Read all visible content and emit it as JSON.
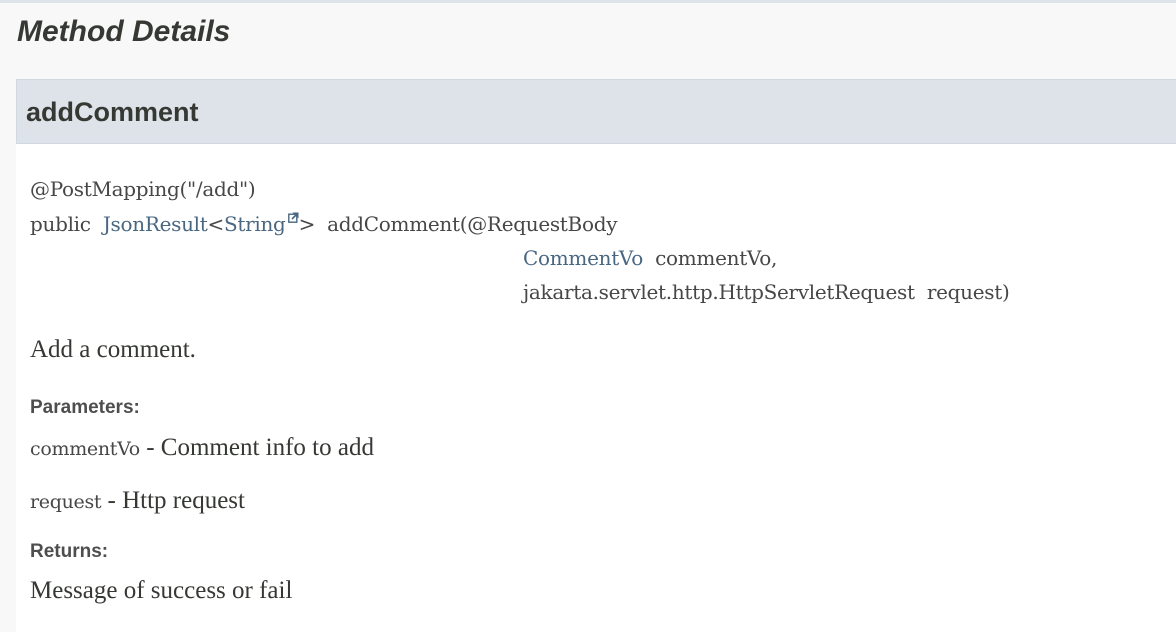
{
  "section": {
    "title": "Method Details"
  },
  "method": {
    "name": "addComment",
    "annotation": "@PostMapping(\"/add\")",
    "modifier": "public",
    "return_type": "JsonResult",
    "type_param_open": "<",
    "type_param": "String",
    "type_param_close": ">",
    "method_name": "addComment",
    "paren_open": "(",
    "param1_annotation": "@RequestBody",
    "param1_type": "CommentVo",
    "param1_name": "commentVo,",
    "param2_type": "jakarta.servlet.http.HttpServletRequest",
    "param2_name": "request)",
    "description": "Add a comment.",
    "parameters_label": "Parameters:",
    "parameters": [
      {
        "name": "commentVo",
        "sep": " - ",
        "desc": "Comment info to add"
      },
      {
        "name": "request",
        "sep": " - ",
        "desc": "Http request"
      }
    ],
    "returns_label": "Returns:",
    "returns": "Message of success or fail"
  },
  "icons": {
    "external_link": "external-link-icon"
  },
  "colors": {
    "header_bg": "#dee3e9",
    "section_bg": "#f8f8f8",
    "link": "#4a6782",
    "text": "#353833"
  }
}
